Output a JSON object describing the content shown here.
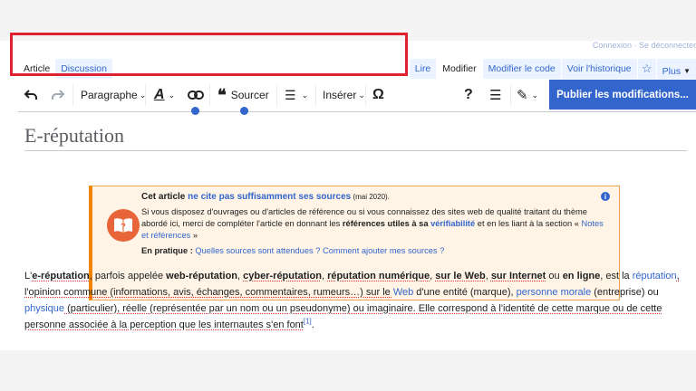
{
  "top_links": "Connexion · Se déconnecter",
  "tabs_left": [
    "Article",
    "Discussion"
  ],
  "tabs_right": [
    "Lire",
    "Modifier",
    "Modifier le code",
    "Voir l'historique"
  ],
  "more_label": "Plus",
  "toolbar": {
    "paragraph_label": "Paragraphe",
    "cite_label": "Sourcer",
    "insert_label": "Insérer",
    "publish_label": "Publier les modifications..."
  },
  "page_title": "E-réputation",
  "notice": {
    "head_pre": "Cet article ",
    "head_link": "ne cite pas suffisamment ses sources",
    "head_date": " (mai 2020).",
    "body1": "Si vous disposez d'ouvrages ou d'articles de référence ou si vous connaissez des sites web de qualité traitant du thème abordé ici, merci de compléter l'article en donnant les ",
    "body_bold": "références utiles à sa ",
    "body_link": "vérifiabilité",
    "body2": " et en les liant à la section « ",
    "body_link2": "Notes et références",
    "body3": " »",
    "practice_label": "En pratique : ",
    "practice_link": "Quelles sources sont attendues ? Comment ajouter mes sources ?"
  },
  "article": {
    "p1": "L'",
    "b1": "e-réputation",
    "p2": ", parfois appelée ",
    "b2": "web-réputation",
    "p3": ", ",
    "b3": "cyber-réputation",
    "p4": ", ",
    "b4": "réputation numérique",
    "p5": ", ",
    "b5": "sur le Web",
    "p6": ", ",
    "b6": "sur Internet",
    "p7": " ou ",
    "b7": "en ligne",
    "p8": ", est la ",
    "l1": "réputation",
    "p9": ", l'opinion commune (informations, avis, échanges, commentaires, rumeurs…) sur le ",
    "l2": "Web",
    "p10": " d'une entité (marque), ",
    "l3": "personne morale",
    "p11": " (entreprise) ou ",
    "l4": "physique",
    "p12": " (particulier), réelle (représentée par un nom ou un pseudonyme) ou imaginaire. Elle correspond à l'identité de cette marque ou de cette personne associée à la perception que les internautes s'en font",
    "ref": "[1]",
    "p13": "."
  },
  "colors": {
    "accent": "#3366cc",
    "highlight": "#e0212f",
    "notice_border": "#f28500"
  }
}
